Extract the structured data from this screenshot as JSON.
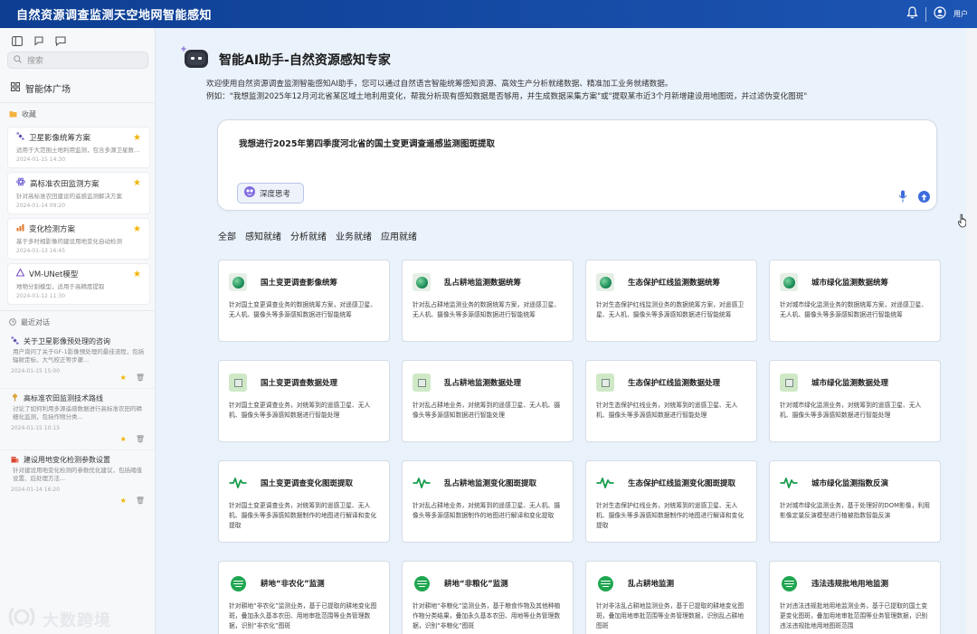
{
  "app": {
    "title": "自然资源调查监测天空地网智能感知",
    "user_label": "用户"
  },
  "sidebar": {
    "search_placeholder": "搜索",
    "agent_square": "智能体广场",
    "favorites_label": "收藏",
    "favorites": [
      {
        "title": "卫星影像统筹方案",
        "desc": "适用于大范围土地利用监测，包含多源卫星数据筛选处理流程",
        "time": "2024-01-15 14:30",
        "icon": "satellite-icon"
      },
      {
        "title": "高标准农田监测方案",
        "desc": "针对高标准农田建设的遥感监测解决方案",
        "time": "2024-01-14 09:20",
        "icon": "atom-icon"
      },
      {
        "title": "变化检测方案",
        "desc": "基于多时相影像的建设用地变化自动检测",
        "time": "2024-01-13 16:45",
        "icon": "chart-icon"
      },
      {
        "title": "VM-UNet模型",
        "desc": "地物分割模型，适用于高精度提取",
        "time": "2024-01-12 11:30",
        "icon": "model-icon"
      }
    ],
    "recent_label": "最近对话",
    "recent": [
      {
        "title": "关于卫星影像预处理的咨询",
        "desc": "用户询问了关于GF-1影像预处理的最佳流程，包括辐射定标、大气校正等步骤...",
        "time": "2024-01-15 15:00"
      },
      {
        "title": "高标准农田监测技术路线",
        "desc": "讨论了如何利用多源遥感数据进行高标准农田的精细化监测，包括作物分类...",
        "time": "2024-01-15 10:15"
      },
      {
        "title": "建设用地变化检测参数设置",
        "desc": "针对建设用地变化检测的参数优化建议，包括阈值设置、后处理方法...",
        "time": "2024-01-14 16:20"
      }
    ],
    "watermark": "大数跨境"
  },
  "main": {
    "heading": "智能AI助手-自然资源感知专家",
    "intro_line1": "欢迎使用自然资源调查监测智能感知AI助手，您可以通过自然语言智能统筹感知资源、高效生产分析就绪数据、精准加工业务就绪数据。",
    "intro_line2": "例如：\"我想监测2025年12月河北省某区域土地利用变化，帮我分析现有感知数据是否够用，并生成数据采集方案\"或\"提取某市近3个月新增建设用地图斑，并过滤伪变化图斑\"",
    "query": "我想进行2025年第四季度河北省的国土变更调查遥感监测图斑提取",
    "deep_think": "深度思考",
    "tabs": [
      "全部",
      "感知就绪",
      "分析就绪",
      "业务就绪",
      "应用就绪"
    ],
    "cards": [
      {
        "icon": "globe",
        "title": "国土变更调查影像统筹",
        "desc": "针对国土变更调查业务的数据统筹方案，对遥感卫星、无人机、摄像头等多源感知数据进行智能统筹"
      },
      {
        "icon": "globe",
        "title": "乱占耕地监测数据统筹",
        "desc": "针对乱占耕地监测业务的数据统筹方案，对遥感卫星、无人机、摄像头等多源感知数据进行智能统筹"
      },
      {
        "icon": "globe",
        "title": "生态保护红线监测数据统筹",
        "desc": "针对生态保护红线监测业务的数据统筹方案，对遥感卫星、无人机、摄像头等多源感知数据进行智能统筹"
      },
      {
        "icon": "globe",
        "title": "城市绿化监测数据统筹",
        "desc": "针对城市绿化监测业务的数据统筹方案，对遥感卫星、无人机、摄像头等多源感知数据进行智能统筹"
      },
      {
        "icon": "proc",
        "title": "国土变更调查数据处理",
        "desc": "针对国土变更调查业务，对统筹到的遥感卫星、无人机、摄像头等多源感知数据进行智能处理"
      },
      {
        "icon": "proc",
        "title": "乱占耕地监测数据处理",
        "desc": "针对乱占耕地业务，对统筹到的遥感卫星、无人机、摄像头等多源感知数据进行智能处理"
      },
      {
        "icon": "proc",
        "title": "生态保护红线监测数据处理",
        "desc": "针对生态保护红线业务，对统筹到的遥感卫星、无人机、摄像头等多源感知数据进行智能处理"
      },
      {
        "icon": "proc",
        "title": "城市绿化监测数据处理",
        "desc": "针对城市绿化监测业务，对统筹到的遥感卫星、无人机、摄像头等多源感知数据进行智能处理"
      },
      {
        "icon": "pulse",
        "title": "国土变更调查变化图斑提取",
        "desc": "针对国土变更调查业务，对统筹到的遥感卫星、无人机、摄像头等多源感知数据制作的地图进行解译和变化提取"
      },
      {
        "icon": "pulse",
        "title": "乱占耕地监测变化图斑提取",
        "desc": "针对乱占耕地业务，对统筹到的遥感卫星、无人机、摄像头等多源感知数据制作的地图进行解译和变化提取"
      },
      {
        "icon": "pulse",
        "title": "生态保护红线监测变化图斑提取",
        "desc": "针对生态保护红线业务，对统筹到的遥感卫星、无人机、摄像头等多源感知数据制作的地图进行解译和变化提取"
      },
      {
        "icon": "pulse",
        "title": "城市绿化监测指数反演",
        "desc": "针对城市绿化监测业务，基于处理好的DOM影像，利用影像定量反演模型进行植被指数智能反演"
      },
      {
        "icon": "spot",
        "title": "耕地“非农化”监测",
        "desc": "针对耕地“非农化”监测业务，基于已提取的耕地变化图斑，叠加永久基本农田、用地审批范围等业务管理数据，识别“非农化”图斑"
      },
      {
        "icon": "spot",
        "title": "耕地“非粮化”监测",
        "desc": "针对耕地“非粮化”监测业务，基于粮食作物及其他种植作物分类结果，叠加永久基本农田、用地等业务管理数据，识别“非粮化”图斑"
      },
      {
        "icon": "spot",
        "title": "乱占耕地监测",
        "desc": "针对非法乱占耕地监测业务，基于已提取的耕地变化图斑，叠加用地审批范围等业务管理数据，识别乱占耕地图斑"
      },
      {
        "icon": "spot",
        "title": "违法违规批地用地监测",
        "desc": "针对违法违规批地用地监测业务，基于已提取的国土变更变化图斑，叠加用地审批范围等业务管理数据，识别违法违规批地用地图斑范围"
      }
    ]
  }
}
